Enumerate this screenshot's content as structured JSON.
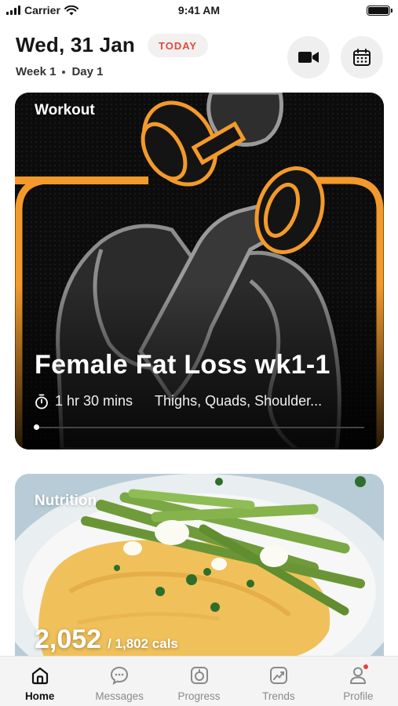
{
  "status_bar": {
    "carrier": "Carrier",
    "time": "9:41 AM"
  },
  "header": {
    "date": "Wed, 31 Jan",
    "today_badge": "TODAY",
    "week": "Week 1",
    "day": "Day 1",
    "video_button_icon": "video-camera-icon",
    "calendar_button_icon": "calendar-icon"
  },
  "workout_card": {
    "label": "Workout",
    "title": "Female Fat Loss wk1-1",
    "duration": "1 hr 30 mins",
    "muscles": "Thighs, Quads, Shoulder...",
    "accent_color": "#f39a2b"
  },
  "nutrition_card": {
    "label": "Nutrition",
    "calories_consumed": "2,052",
    "calories_target": "/ 1,802 cals"
  },
  "tab_bar": {
    "items": [
      {
        "label": "Home",
        "icon": "home-icon",
        "active": true
      },
      {
        "label": "Messages",
        "icon": "chat-icon",
        "active": false
      },
      {
        "label": "Progress",
        "icon": "progress-icon",
        "active": false
      },
      {
        "label": "Trends",
        "icon": "trends-icon",
        "active": false
      },
      {
        "label": "Profile",
        "icon": "profile-icon",
        "active": false
      }
    ]
  },
  "colors": {
    "today_text": "#e24a3c",
    "notification_dot": "#e8413a"
  }
}
